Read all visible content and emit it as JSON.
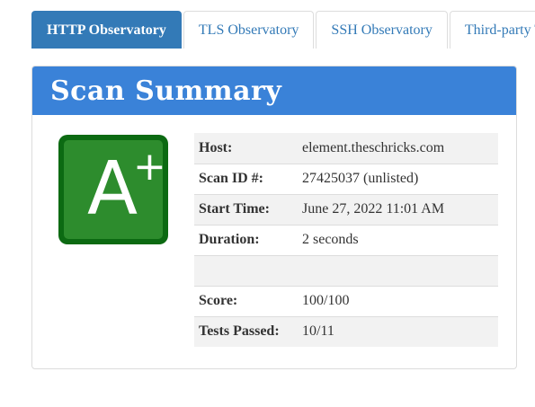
{
  "tabs": [
    {
      "label": "HTTP Observatory",
      "active": true
    },
    {
      "label": "TLS Observatory",
      "active": false
    },
    {
      "label": "SSH Observatory",
      "active": false
    },
    {
      "label": "Third-party Tests",
      "active": false
    }
  ],
  "panel": {
    "title": "Scan Summary",
    "heading_color": "#3a82d8"
  },
  "grade": {
    "letter": "A",
    "modifier": "+",
    "color": "#2d8c2d"
  },
  "summary": {
    "rows": [
      {
        "label": "Host:",
        "value": "element.theschricks.com"
      },
      {
        "label": "Scan ID #:",
        "value": "27425037 (unlisted)"
      },
      {
        "label": "Start Time:",
        "value": "June 27, 2022 11:01 AM"
      },
      {
        "label": "Duration:",
        "value": "2 seconds"
      },
      {
        "label": "",
        "value": ""
      },
      {
        "label": "Score:",
        "value": "100/100"
      },
      {
        "label": "Tests Passed:",
        "value": "10/11"
      }
    ]
  }
}
